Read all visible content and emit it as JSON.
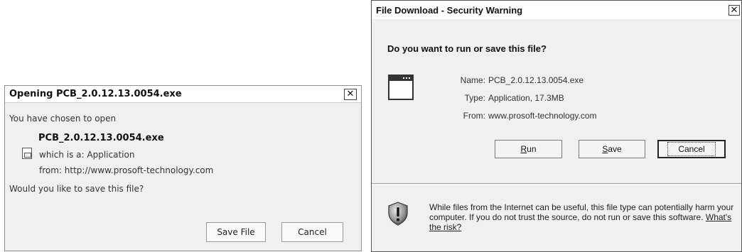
{
  "left_dialog": {
    "title": "Opening PCB_2.0.12.13.0054.exe",
    "close_glyph": "✕",
    "intro": "You have chosen to open",
    "filename": "PCB_2.0.12.13.0054.exe",
    "which_is_a": "which is a:  Application",
    "from": "from:  http://www.prosoft-technology.com",
    "question": "Would you like to save this file?",
    "save_button": "Save File",
    "cancel_button": "Cancel",
    "icons": {
      "file": "file-icon",
      "close": "close-icon"
    }
  },
  "right_dialog": {
    "title": "File Download - Security Warning",
    "close_glyph": "✕",
    "question": "Do you want to run or save this file?",
    "fields": [
      {
        "label": "Name:",
        "value": "PCB_2.0.12.13.0054.exe"
      },
      {
        "label": "Type:",
        "value": "Application, 17.3MB"
      },
      {
        "label": "From:",
        "value": "www.prosoft-technology.com"
      }
    ],
    "run_button": {
      "mnemonic": "R",
      "rest": "un"
    },
    "save_button": {
      "mnemonic": "S",
      "rest": "ave"
    },
    "cancel_button": "Cancel",
    "warning_text": "While files from the Internet can be useful, this file type can potentially harm your computer. If you do not trust the source, do not run or save this software. ",
    "risk_link": "What's the risk?",
    "icons": {
      "app": "application-icon",
      "shield": "shield-icon",
      "close": "close-icon"
    }
  }
}
